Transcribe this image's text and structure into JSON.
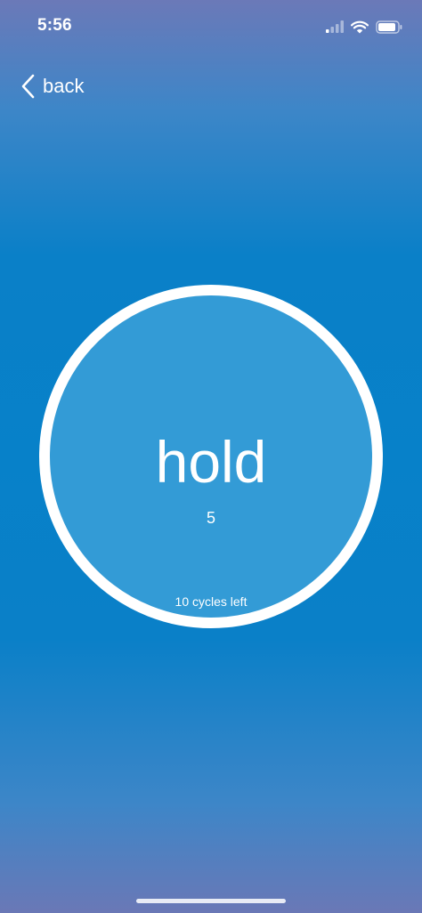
{
  "status_bar": {
    "time": "5:56",
    "icons": [
      "cellular-signal-icon",
      "wifi-icon",
      "battery-icon"
    ]
  },
  "nav": {
    "back_label": "back",
    "back_icon": "chevron-left-icon"
  },
  "breathing": {
    "phase": "hold",
    "count": "5",
    "cycles_left": "10 cycles left"
  },
  "colors": {
    "background_center": "#0781c9",
    "background_edge": "#6b79b8",
    "circle_fill": "#339bd6",
    "circle_ring": "#ffffff",
    "text": "#ffffff"
  }
}
